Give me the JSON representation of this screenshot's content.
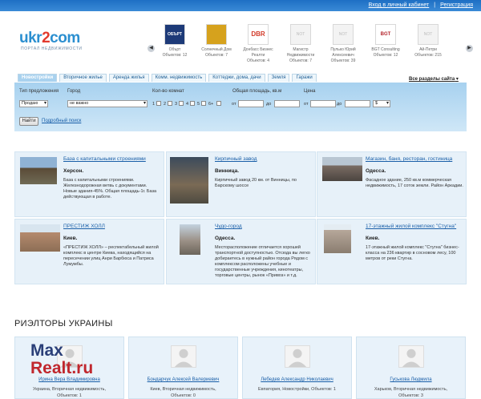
{
  "topbar": {
    "login_label": "Вход в личный кабинет",
    "separator": "|",
    "register_label": "Регистрация"
  },
  "logo": {
    "wordmark_pre": "ukr",
    "wordmark_accent": "2",
    "wordmark_post": "com",
    "tagline": "портал недвижимости"
  },
  "agencies": [
    {
      "name": "Обърт",
      "count": "Объектов: 12",
      "thumb": "ОБЪРТ"
    },
    {
      "name": "Солнечный Дом",
      "count": "Объектов: 7",
      "thumb": ""
    },
    {
      "name": "Донбасс Бизнес Реалти",
      "count": "Объектов: 4",
      "thumb": "DBR"
    },
    {
      "name": "Магистр Недвижимости",
      "count": "Объектов: 7",
      "thumb": "NOT FOUND"
    },
    {
      "name": "Пулько Юрий Алексеевич",
      "count": "Объектов: 39",
      "thumb": "NOT FOUND"
    },
    {
      "name": "BGT Consulting",
      "count": "Объектов: 12",
      "thumb": "BGT"
    },
    {
      "name": "Ай-Петри",
      "count": "Объектов: 215",
      "thumb": "NOT FOUND"
    }
  ],
  "tabs": [
    "Новостройки",
    "Вторичное жилье",
    "Аренда жилья",
    "Комм. недвижимость",
    "Коттеджи, дома, дачи",
    "Земля",
    "Гаражи"
  ],
  "all_sections_label": "Все разделы сайта",
  "search": {
    "offer_type_label": "Тип предложения",
    "offer_type_value": "Продаю",
    "city_label": "Город",
    "city_value": "не важно",
    "rooms_label": "Кол-во комнат",
    "rooms": [
      "1",
      "2",
      "3",
      "4",
      "5",
      "6+"
    ],
    "area_label": "Общая площадь, кв.м",
    "price_label": "Цена",
    "from_label": "от",
    "to_label": "до",
    "currency_value": "$",
    "find_button": "Найти",
    "advanced_link": "Подробный поиск"
  },
  "listings": [
    {
      "title": "База с капитальными строениями",
      "city": "Херсон.",
      "desc": "База с капитальными строениями. Железнодорожная ветвь с документами. Новые здания-45%. Общая площадь-1г. База действующая в работе."
    },
    {
      "title": "Кирпичный завод",
      "city": "Винница.",
      "desc": "Кирпичный завод 20 км. от Винницы, по Барскому шоссе"
    },
    {
      "title": "Магазин, баня, ресторан, гостиница",
      "city": "Одесса.",
      "desc": "Фасадное здание, 250 кв.м коммерческая недвижимость, 17 соток земли. Район Аркадии."
    },
    {
      "title": "ПРЕСТИЖ ХОЛЛ",
      "city": "Киев.",
      "desc": "«ПРЕСТИЖ ХОЛЛ» – респектабельный жилой комплекс в центре Киева, находящийся на пересечении улиц Анри Барбюса и Патриса Лумумбы."
    },
    {
      "title": "Чудо-город",
      "city": "Одесса.",
      "desc": "Месторасположение отличается хорошей транспортной доступностью. Отсюда вы легко добираетесь в нужный район города Рядом с комплексом расположены учебные и государственные учреждения, кинотеатры, торговые центры, рынок «Привоз» и т.д."
    },
    {
      "title": "17-этажный жилой комплекс \"Стугна\"",
      "city": "Киев.",
      "desc": "17-этажный жилой комплекс \"Стугна\" бизнес-класса на 236 квартир в сосновом лесу, 100 метров от реки Стугна."
    }
  ],
  "realtors_title": "РИЭЛТОРЫ УКРАИНЫ",
  "realtors": [
    {
      "name": "Ирина Вера Владимировна",
      "info": "Украина, Вторичная недвижимость,",
      "count": "Объектов: 1"
    },
    {
      "name": "Бондарчук Алексей Валериевич",
      "info": "Киев, Вторичная недвижимость,",
      "count": "Объектов: 0"
    },
    {
      "name": "Лебедев Александр Николаевич",
      "info": "Евпатория, Новостройки, Объектов: 1",
      "count": ""
    },
    {
      "name": "Гуськова Людмила",
      "info": "Харьков, Вторичная недвижимость,",
      "count": "Объектов: 3"
    }
  ],
  "watermark": {
    "line1": "Max",
    "line2": "Realt.ru"
  }
}
